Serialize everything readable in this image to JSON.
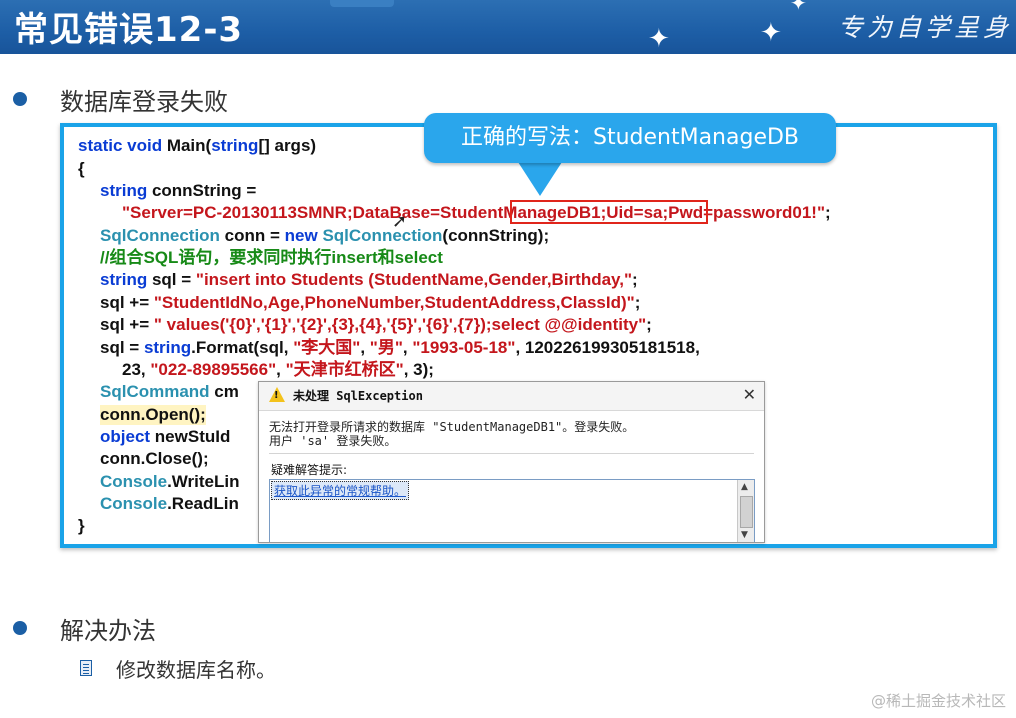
{
  "header": {
    "title": "常见错误12-3",
    "brand": "专为自学呈身"
  },
  "bullets": {
    "first": "数据库登录失败",
    "second": "解决办法",
    "sub_item": "修改数据库名称。"
  },
  "callout": {
    "text": "正确的写法：StudentManageDB"
  },
  "code": {
    "line1": [
      {
        "t": "static void ",
        "c": "kw"
      },
      {
        "t": "Main(",
        "c": "pl"
      },
      {
        "t": "string",
        "c": "kw"
      },
      {
        "t": "[] args)",
        "c": "pl"
      }
    ],
    "line2": [
      {
        "t": "{",
        "c": "pl"
      }
    ],
    "line3": [
      {
        "t": "string ",
        "c": "kw"
      },
      {
        "t": "connString =",
        "c": "pl"
      }
    ],
    "line4": [
      {
        "t": "\"Server=PC-20130113SMNR;DataBase=StudentManageDB1;Uid=sa;Pwd=password01!\"",
        "c": "st"
      },
      {
        "t": ";",
        "c": "pl"
      }
    ],
    "line5": [
      {
        "t": "SqlConnection ",
        "c": "tp"
      },
      {
        "t": "conn",
        "c": "pl"
      },
      {
        "t": " = ",
        "c": "pl"
      },
      {
        "t": "new ",
        "c": "kw"
      },
      {
        "t": "SqlConnection",
        "c": "tp"
      },
      {
        "t": "(connString);",
        "c": "pl"
      }
    ],
    "line6": [
      {
        "t": "//组合SQL语句，要求同时执行insert和select",
        "c": "cm"
      }
    ],
    "line7": [
      {
        "t": "string ",
        "c": "kw"
      },
      {
        "t": "sql = ",
        "c": "pl"
      },
      {
        "t": "\"insert into Students (StudentName,Gender,Birthday,\"",
        "c": "st"
      },
      {
        "t": ";",
        "c": "pl"
      }
    ],
    "line8": [
      {
        "t": "sql += ",
        "c": "pl"
      },
      {
        "t": "\"StudentIdNo,Age,PhoneNumber,StudentAddress,ClassId)\"",
        "c": "st"
      },
      {
        "t": ";",
        "c": "pl"
      }
    ],
    "line9": [
      {
        "t": "sql += ",
        "c": "pl"
      },
      {
        "t": "\" values('{0}','{1}','{2}',{3},{4},'{5}','{6}',{7});select @@identity\"",
        "c": "st"
      },
      {
        "t": ";",
        "c": "pl"
      }
    ],
    "line10": [
      {
        "t": "sql = ",
        "c": "pl"
      },
      {
        "t": "string",
        "c": "kw"
      },
      {
        "t": ".Format(sql, ",
        "c": "pl"
      },
      {
        "t": "\"李大国\"",
        "c": "st"
      },
      {
        "t": ", ",
        "c": "pl"
      },
      {
        "t": "\"男\"",
        "c": "st"
      },
      {
        "t": ", ",
        "c": "pl"
      },
      {
        "t": "\"1993-05-18\"",
        "c": "st"
      },
      {
        "t": ", 120226199305181518,",
        "c": "pl"
      }
    ],
    "line11": [
      {
        "t": "23, ",
        "c": "pl"
      },
      {
        "t": "\"022-89895566\"",
        "c": "st"
      },
      {
        "t": ", ",
        "c": "pl"
      },
      {
        "t": "\"天津市红桥区\"",
        "c": "st"
      },
      {
        "t": ", 3);",
        "c": "pl"
      }
    ],
    "line12": [
      {
        "t": "SqlCommand ",
        "c": "tp"
      },
      {
        "t": "cm",
        "c": "pl"
      }
    ],
    "line13": [
      {
        "t": "conn.Open();",
        "c": "pl"
      }
    ],
    "line14": [
      {
        "t": "object ",
        "c": "kw"
      },
      {
        "t": "newStuId",
        "c": "pl"
      }
    ],
    "line15": [
      {
        "t": "conn.Close();",
        "c": "pl"
      }
    ],
    "line16": [
      {
        "t": "Console",
        "c": "tp"
      },
      {
        "t": ".WriteLin",
        "c": "pl"
      }
    ],
    "line17": [
      {
        "t": "Console",
        "c": "tp"
      },
      {
        "t": ".ReadLin",
        "c": "pl"
      }
    ],
    "line18": [
      {
        "t": "}",
        "c": "pl"
      }
    ]
  },
  "dialog": {
    "title": "未处理 SqlException",
    "message_line1": "无法打开登录所请求的数据库 \"StudentManageDB1\"。登录失败。",
    "message_line2": "用户 'sa' 登录失败。",
    "help_label": "疑难解答提示:",
    "help_link": "获取此异常的常规帮助。"
  },
  "watermark": "@稀土掘金技术社区",
  "colors": {
    "header_bg": "#1d5ea6",
    "frame_border": "#1aa3e8",
    "callout_bg": "#2aa6ec",
    "keyword": "#0a3cd4",
    "type": "#2b91af",
    "string": "#c4161c",
    "comment": "#178a17",
    "error_box": "#e0251b"
  }
}
